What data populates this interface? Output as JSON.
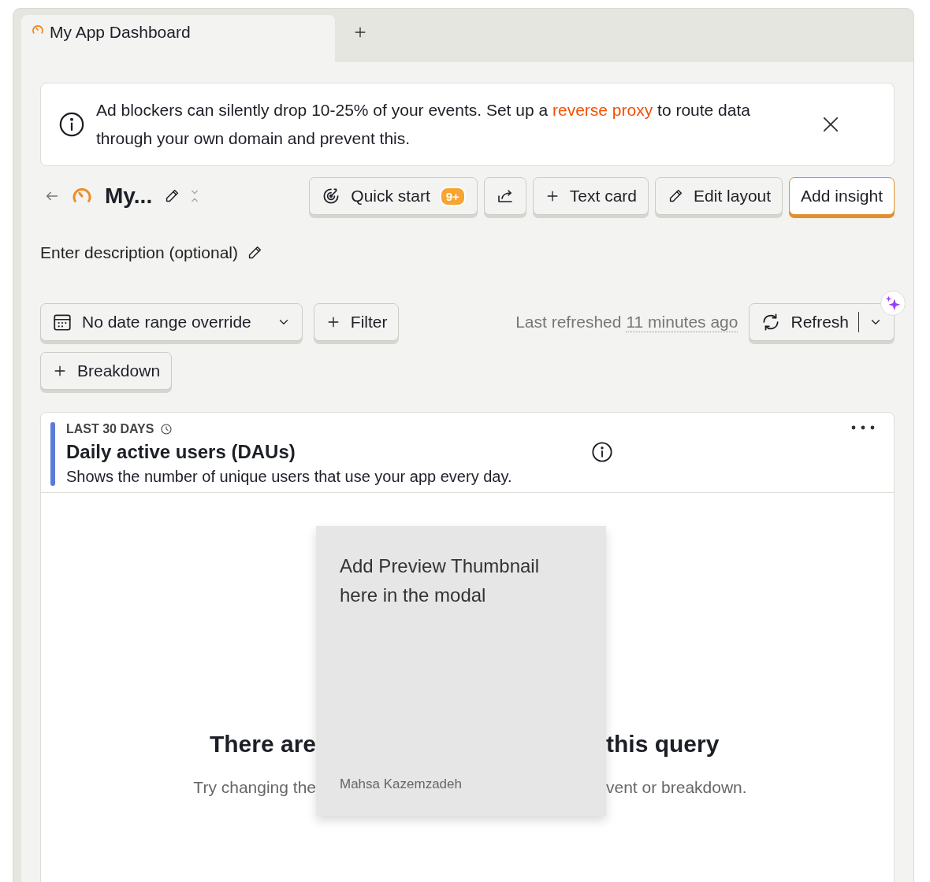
{
  "tabs": [
    {
      "label": "My App Dashboard",
      "selected": true
    }
  ],
  "banner": {
    "text_before": "Ad blockers can silently drop 10-25% of your events. Set up a",
    "link": "reverse proxy",
    "text_after": "to route data through your own domain and prevent this."
  },
  "header": {
    "title": "My...",
    "buttons": [
      {
        "kind": "quick_start",
        "label": "Quick start",
        "badge": "9+"
      },
      {
        "kind": "share"
      },
      {
        "kind": "text_card",
        "label": "Text card"
      },
      {
        "kind": "edit",
        "label": "Edit layout"
      },
      {
        "kind": "primary",
        "label": "Add insight"
      }
    ]
  },
  "description": "Enter description (optional)",
  "filters": {
    "date_range": "No date range override",
    "filter": "Filter",
    "breakdown": "Breakdown",
    "last_refreshed": "Last refreshed",
    "refreshed_ago": "11 minutes ago",
    "refresh": "Refresh"
  },
  "insight": {
    "period": "LAST 30 DAYS",
    "title": "Daily active users (DAUs)",
    "description": "Shows the number of unique users that use your app every day.",
    "empty_title_parts": [
      "There are",
      "this query"
    ],
    "empty_hint_parts": [
      "Try changing the",
      "vent or breakdown."
    ]
  },
  "overlay": {
    "text": "Add Preview Thumbnail here in the modal",
    "author": "Mahsa Kazemzadeh"
  }
}
